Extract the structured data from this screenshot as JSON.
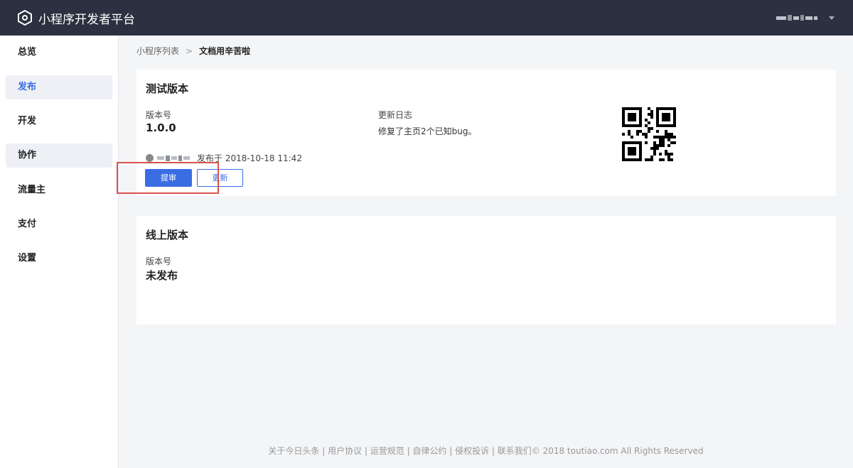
{
  "app": {
    "title": "小程序开发者平台"
  },
  "sidebar": {
    "items": [
      {
        "label": "总览"
      },
      {
        "label": "发布"
      },
      {
        "label": "开发"
      },
      {
        "label": "协作"
      },
      {
        "label": "流量主"
      },
      {
        "label": "支付"
      },
      {
        "label": "设置"
      }
    ]
  },
  "breadcrumb": {
    "parent": "小程序列表",
    "current": "文档用辛苦啦"
  },
  "test_version": {
    "title": "测试版本",
    "version_label": "版本号",
    "version": "1.0.0",
    "log_label": "更新日志",
    "log": "修复了主页2个已知bug。",
    "published_text": "发布于 2018-10-18 11:42",
    "submit_label": "提审",
    "update_label": "更新"
  },
  "online_version": {
    "title": "线上版本",
    "version_label": "版本号",
    "version": "未发布"
  },
  "footer": {
    "text": "关于今日头条 | 用户协议 | 运营规范 | 自律公约 | 侵权投诉 | 联系我们© 2018 toutiao.com All Rights Reserved"
  },
  "colors": {
    "topbar": "#2b3140",
    "accent": "#3a6de2",
    "highlight": "#d9534f"
  },
  "icons": {
    "logo": "app-logo-icon",
    "dropdown": "caret-down-icon",
    "avatar": "avatar-icon",
    "qr": "qr-code"
  }
}
